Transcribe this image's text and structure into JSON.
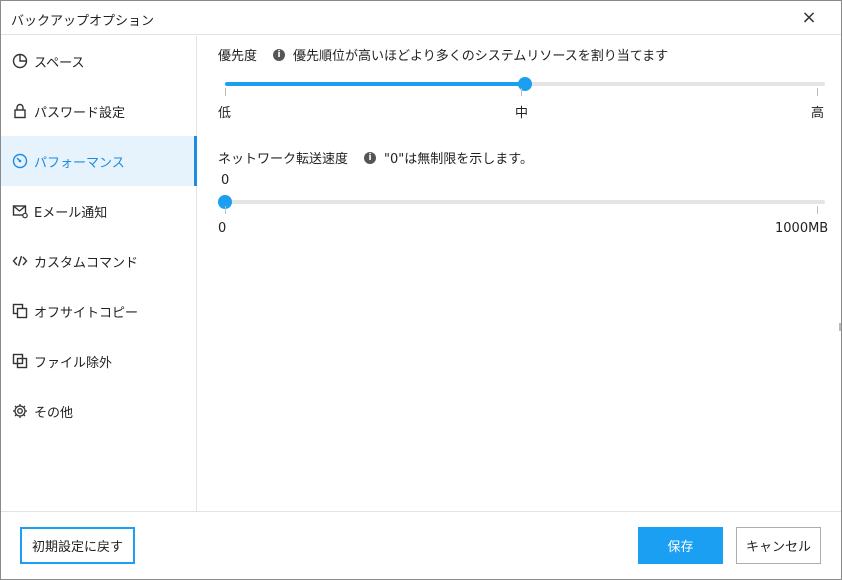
{
  "window": {
    "title": "バックアップオプション",
    "close_glyph": "×"
  },
  "sidebar": {
    "items": [
      {
        "label": "スペース",
        "icon": "pie-chart-icon",
        "active": false
      },
      {
        "label": "パスワード設定",
        "icon": "lock-icon",
        "active": false
      },
      {
        "label": "パフォーマンス",
        "icon": "speedometer-icon",
        "active": true
      },
      {
        "label": "Eメール通知",
        "icon": "mail-bell-icon",
        "active": false
      },
      {
        "label": "カスタムコマンド",
        "icon": "code-icon",
        "active": false
      },
      {
        "label": "オフサイトコピー",
        "icon": "copy-icon",
        "active": false
      },
      {
        "label": "ファイル除外",
        "icon": "exclude-icon",
        "active": false
      },
      {
        "label": "その他",
        "icon": "gear-icon",
        "active": false
      }
    ]
  },
  "priority": {
    "label": "優先度",
    "hint": "優先順位が高いほどより多くのシステムリソースを割り当てます",
    "min_label": "低",
    "mid_label": "中",
    "max_label": "高",
    "level": 0.5
  },
  "network": {
    "label": "ネットワーク転送速度",
    "hint": "\"0\"は無制限を示します。",
    "current_value": "0",
    "min_label": "0",
    "max_label": "1000MB",
    "level": 0
  },
  "footer": {
    "reset_label": "初期設定に戻す",
    "save_label": "保存",
    "cancel_label": "キャンセル"
  },
  "colors": {
    "accent": "#1a9ff2",
    "active_bg": "#e6f2fc",
    "active_text": "#1e8ce0"
  }
}
